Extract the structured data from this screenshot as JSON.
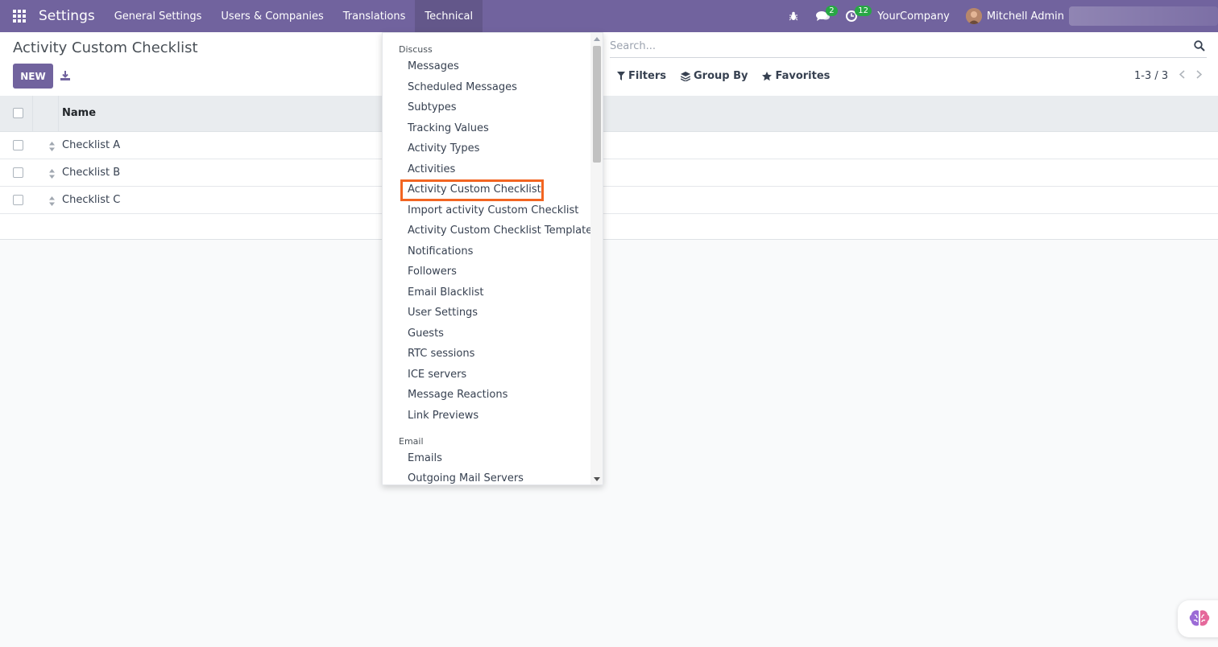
{
  "navbar": {
    "app_name": "Settings",
    "menus": [
      "General Settings",
      "Users & Companies",
      "Translations",
      "Technical"
    ],
    "messages_count": "2",
    "activities_count": "12",
    "company": "YourCompany",
    "user": "Mitchell Admin",
    "accent_color": "#71639e"
  },
  "control_panel": {
    "title": "Activity Custom Checklist",
    "new_label": "NEW",
    "search_placeholder": "Search...",
    "filters_label": "Filters",
    "group_by_label": "Group By",
    "favorites_label": "Favorites",
    "pager": "1-3 / 3"
  },
  "list": {
    "column_name": "Name",
    "rows": [
      "Checklist A",
      "Checklist B",
      "Checklist C"
    ]
  },
  "dropdown": {
    "sections": [
      {
        "header": "Discuss",
        "items": [
          "Messages",
          "Scheduled Messages",
          "Subtypes",
          "Tracking Values",
          "Activity Types",
          "Activities",
          "Activity Custom Checklist",
          "Import activity Custom Checklist",
          "Activity Custom Checklist Template",
          "Notifications",
          "Followers",
          "Email Blacklist",
          "User Settings",
          "Guests",
          "RTC sessions",
          "ICE servers",
          "Message Reactions",
          "Link Previews"
        ]
      },
      {
        "header": "Email",
        "items": [
          "Emails",
          "Outgoing Mail Servers"
        ]
      }
    ],
    "highlight_color": "#f26522"
  }
}
